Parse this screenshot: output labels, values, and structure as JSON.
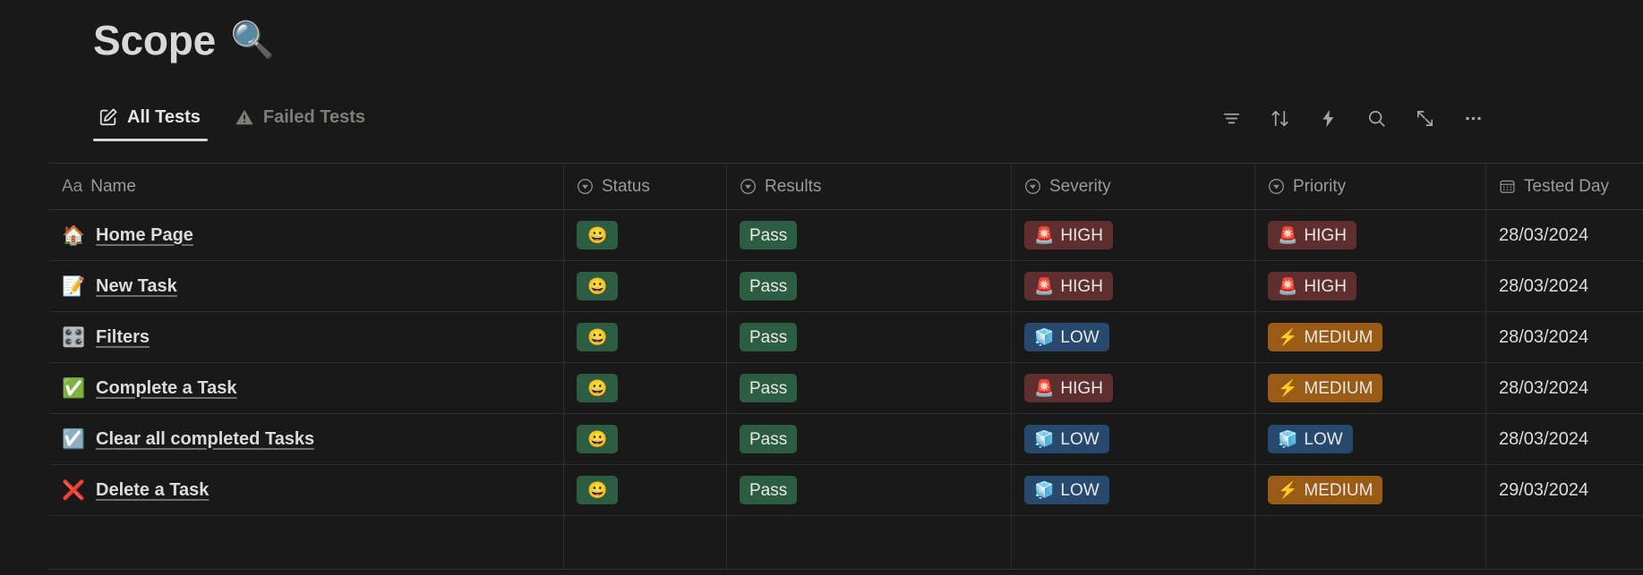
{
  "header": {
    "title": "Scope",
    "title_emoji": "🔍",
    "title_emoji_name": "magnifying-glass-icon"
  },
  "tabs": [
    {
      "label": "All Tests",
      "icon": "edit-square-icon",
      "active": true
    },
    {
      "label": "Failed Tests",
      "icon": "warning-triangle-icon",
      "active": false
    }
  ],
  "toolbar": [
    {
      "name": "filter-icon",
      "label": "Filter"
    },
    {
      "name": "sort-icon",
      "label": "Sort"
    },
    {
      "name": "lightning-icon",
      "label": "Automations"
    },
    {
      "name": "search-icon",
      "label": "Search"
    },
    {
      "name": "expand-icon",
      "label": "Expand"
    },
    {
      "name": "more-icon",
      "label": "More options"
    }
  ],
  "table": {
    "columns": [
      {
        "key": "name",
        "label": "Name",
        "icon": "text-aa-icon"
      },
      {
        "key": "status",
        "label": "Status",
        "icon": "select-icon"
      },
      {
        "key": "results",
        "label": "Results",
        "icon": "select-icon"
      },
      {
        "key": "severity",
        "label": "Severity",
        "icon": "select-icon"
      },
      {
        "key": "priority",
        "label": "Priority",
        "icon": "select-icon"
      },
      {
        "key": "date",
        "label": "Tested Day",
        "icon": "calendar-icon"
      }
    ],
    "rows": [
      {
        "name": "Home Page",
        "name_emoji": "🏠",
        "name_icon": "house-icon",
        "status_emoji": "😀",
        "status_icon": "grinning-face-icon",
        "status_color": "green",
        "results": "Pass",
        "results_color": "green",
        "severity": "HIGH",
        "severity_emoji": "🚨",
        "severity_color": "red",
        "priority": "HIGH",
        "priority_emoji": "🚨",
        "priority_color": "red",
        "date": "28/03/2024"
      },
      {
        "name": "New Task",
        "name_emoji": "📝",
        "name_icon": "memo-icon",
        "status_emoji": "😀",
        "status_icon": "grinning-face-icon",
        "status_color": "green",
        "results": "Pass",
        "results_color": "green",
        "severity": "HIGH",
        "severity_emoji": "🚨",
        "severity_color": "red",
        "priority": "HIGH",
        "priority_emoji": "🚨",
        "priority_color": "red",
        "date": "28/03/2024"
      },
      {
        "name": "Filters",
        "name_emoji": "🎛️",
        "name_icon": "sliders-icon",
        "status_emoji": "😀",
        "status_icon": "grinning-face-icon",
        "status_color": "green",
        "results": "Pass",
        "results_color": "green",
        "severity": "LOW",
        "severity_emoji": "🧊",
        "severity_color": "blue",
        "priority": "MEDIUM",
        "priority_emoji": "⚡",
        "priority_color": "orange",
        "date": "28/03/2024"
      },
      {
        "name": "Complete a Task",
        "name_emoji": "✅",
        "name_icon": "check-box-icon",
        "status_emoji": "😀",
        "status_icon": "grinning-face-icon",
        "status_color": "green",
        "results": "Pass",
        "results_color": "green",
        "severity": "HIGH",
        "severity_emoji": "🚨",
        "severity_color": "red",
        "priority": "MEDIUM",
        "priority_emoji": "⚡",
        "priority_color": "orange",
        "date": "28/03/2024"
      },
      {
        "name": "Clear all completed Tasks",
        "name_emoji": "☑️",
        "name_icon": "checklist-icon",
        "status_emoji": "😀",
        "status_icon": "grinning-face-icon",
        "status_color": "green",
        "results": "Pass",
        "results_color": "green",
        "severity": "LOW",
        "severity_emoji": "🧊",
        "severity_color": "blue",
        "priority": "LOW",
        "priority_emoji": "🧊",
        "priority_color": "blue",
        "date": "28/03/2024"
      },
      {
        "name": "Delete a Task",
        "name_emoji": "❌",
        "name_icon": "x-circle-icon",
        "status_emoji": "😀",
        "status_icon": "grinning-face-icon",
        "status_color": "green",
        "results": "Pass",
        "results_color": "green",
        "severity": "LOW",
        "severity_emoji": "🧊",
        "severity_color": "blue",
        "priority": "MEDIUM",
        "priority_emoji": "⚡",
        "priority_color": "orange",
        "date": "29/03/2024"
      }
    ]
  },
  "colors": {
    "background": "#191919",
    "green_pill": "#2c5c42",
    "red_pill": "#5f2e2e",
    "blue_pill": "#28496e",
    "orange_pill": "#9a5b15",
    "accent_icon": "#d79921",
    "text_primary": "#dcdcdb",
    "text_muted": "#9b9b98",
    "border": "#2e2e2d"
  }
}
